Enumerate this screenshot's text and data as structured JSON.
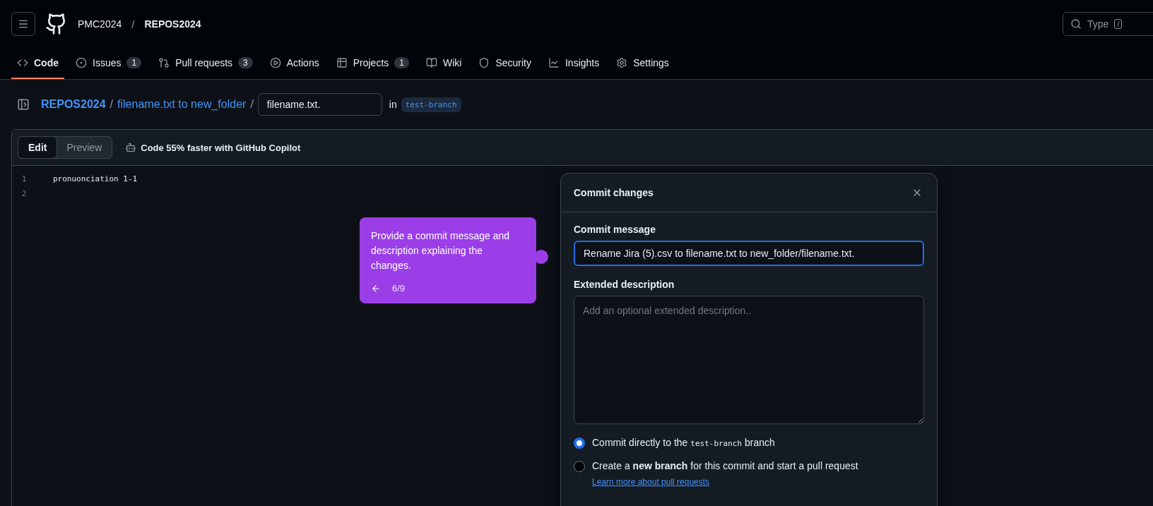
{
  "header": {
    "owner": "PMC2024",
    "separator": "/",
    "repo": "REPOS2024",
    "search": {
      "placeholder": "Type",
      "key": "/"
    }
  },
  "tabs": [
    {
      "label": "Code",
      "selected": true
    },
    {
      "label": "Issues",
      "count": "1",
      "selected": false
    },
    {
      "label": "Pull requests",
      "count": "3",
      "selected": false
    },
    {
      "label": "Actions",
      "selected": false
    },
    {
      "label": "Projects",
      "count": "1",
      "selected": false
    },
    {
      "label": "Wiki",
      "selected": false
    },
    {
      "label": "Security",
      "selected": false
    },
    {
      "label": "Insights",
      "selected": false
    },
    {
      "label": "Settings",
      "selected": false
    }
  ],
  "breadcrumb": {
    "repo": "REPOS2024",
    "separator_1": "/",
    "folder": "filename.txt to new_folder",
    "separator_2": "/",
    "filename": "filename.txt.",
    "in_label": "in",
    "branch": "test-branch"
  },
  "editor": {
    "modes": [
      {
        "label": "Edit",
        "selected": true
      },
      {
        "label": "Preview",
        "selected": false
      }
    ],
    "copilot": "Code 55% faster with GitHub Copilot",
    "lines": [
      {
        "number": "1",
        "text": "pronuonciation 1-1"
      },
      {
        "number": "2"
      }
    ]
  },
  "tooltip": {
    "text": "Provide a commit message and description explaining the changes.",
    "step": "6/9"
  },
  "dialog": {
    "title": "Commit changes",
    "message_label": "Commit message",
    "message": "Rename Jira (5).csv to filename.txt to new_folder/filename.txt.",
    "description_label": "Extended description",
    "description_placeholder": "Add an optional extended description..",
    "options": [
      {
        "kind": "direct",
        "selected": true,
        "text_before": "Commit directly to the",
        "branch": "test-branch",
        "text_after": "branch"
      },
      {
        "kind": "new-branch",
        "selected": false,
        "text": "Create a **new branch** for this commit and start a pull request",
        "link": "Learn more about pull requests"
      }
    ]
  }
}
